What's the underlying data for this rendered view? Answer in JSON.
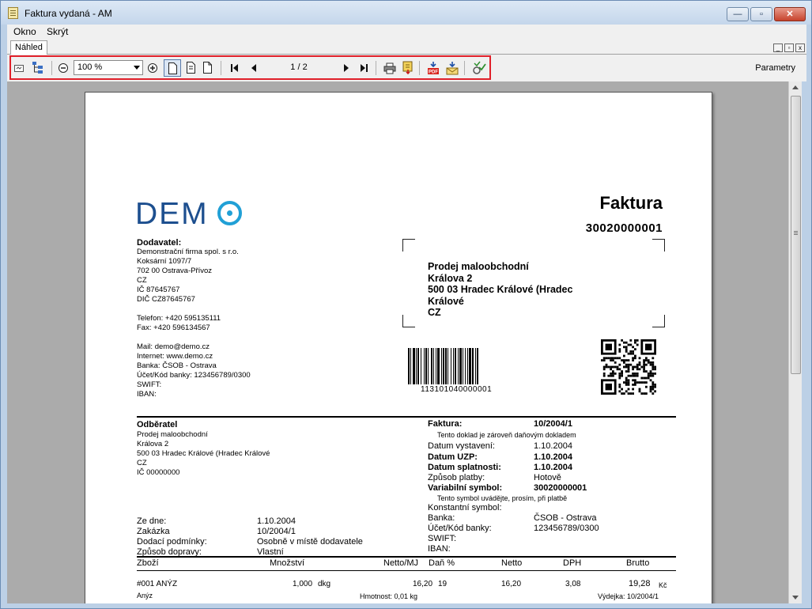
{
  "window": {
    "title": "Faktura vydaná - AM",
    "min_glyph": "—",
    "max_glyph": "▫",
    "close_glyph": "✕"
  },
  "menu": {
    "okno": "Okno",
    "skryt": "Skrýt"
  },
  "tab": {
    "label": "Náhled"
  },
  "toolbar": {
    "zoom_value": "100 %",
    "page_indicator": "1 / 2",
    "parameters_label": "Parametry",
    "icons": [
      "fit-icon",
      "tree-icon",
      "zoom-out-icon",
      "zoom-in-icon",
      "single-page-icon",
      "two-pages-icon",
      "four-pages-icon",
      "first-page-icon",
      "previous-page-icon",
      "next-page-icon",
      "last-page-icon",
      "print-icon",
      "export-icon",
      "pdf-icon",
      "email-icon",
      "sign-icon"
    ]
  },
  "invoice": {
    "logo_text": "DEM",
    "title": "Faktura",
    "number": "30020000001",
    "supplier": {
      "heading": "Dodavatel:",
      "lines": [
        "Demonstrační firma spol. s r.o.",
        "Koksární 1097/7",
        "702 00 Ostrava-Přívoz",
        "CZ",
        "IČ 87645767",
        "DIČ CZ87645767"
      ],
      "contact": [
        "Telefon: +420  595135111",
        "Fax: +420  596134567"
      ],
      "online": [
        "Mail: demo@demo.cz",
        "Internet: www.demo.cz",
        "Banka: ČSOB - Ostrava",
        "Účet/Kód banky: 123456789/0300",
        "SWIFT:",
        "IBAN:"
      ]
    },
    "address_window": [
      "Prodej maloobchodní",
      "Králova 2",
      "500 03 Hradec Králové (Hradec",
      "Králové",
      "CZ"
    ],
    "barcode_text": "113101040000001",
    "customer": {
      "heading": "Odběratel",
      "lines": [
        "Prodej maloobchodní",
        "Králova 2",
        "500 03 Hradec Králové (Hradec Králové",
        "CZ",
        "IČ 00000000"
      ]
    },
    "order_info": [
      {
        "label": "Ze dne:",
        "value": "1.10.2004"
      },
      {
        "label": "Zakázka",
        "value": "10/2004/1"
      },
      {
        "label": "Dodací podmínky:",
        "value": "Osobně v místě dodavatele"
      },
      {
        "label": "Způsob dopravy:",
        "value": "Vlastní"
      }
    ],
    "right_info": {
      "faktura_label": "Faktura:",
      "faktura_value": "10/2004/1",
      "tax_note": "Tento doklad je zároveň daňovým dokladem",
      "rows": [
        {
          "label": "Datum vystavení:",
          "value": "1.10.2004",
          "bold": false
        },
        {
          "label": "Datum UZP:",
          "value": "1.10.2004",
          "bold": true
        },
        {
          "label": "Datum splatnosti:",
          "value": "1.10.2004",
          "bold": true
        },
        {
          "label": "Způsob platby:",
          "value": "Hotově",
          "bold": false
        },
        {
          "label": "Variabilní symbol:",
          "value": "30020000001",
          "bold": true
        }
      ],
      "symbol_note": "Tento symbol uvádějte, prosím, při platbě",
      "rows2": [
        {
          "label": "Konstantní symbol:",
          "value": ""
        },
        {
          "label": "Banka:",
          "value": "ČSOB - Ostrava"
        },
        {
          "label": "Účet/Kód banky:",
          "value": "123456789/0300"
        },
        {
          "label": "SWIFT:",
          "value": ""
        },
        {
          "label": "IBAN:",
          "value": ""
        }
      ]
    },
    "table": {
      "headers": [
        "Zboží",
        "Množství",
        "Netto/MJ",
        "Daň %",
        "Netto",
        "DPH",
        "Brutto"
      ],
      "row": {
        "code": "#001 ANÝZ",
        "qty": "1,000",
        "unit": "dkg",
        "netto_mj": "16,20",
        "tax": "19",
        "netto": "16,20",
        "dph": "3,08",
        "brutto": "19,28",
        "currency": "Kč",
        "name": "Anýz",
        "weight": "Hmotnost: 0,01 kg",
        "issue": "Výdejka: 10/2004/1"
      }
    }
  }
}
